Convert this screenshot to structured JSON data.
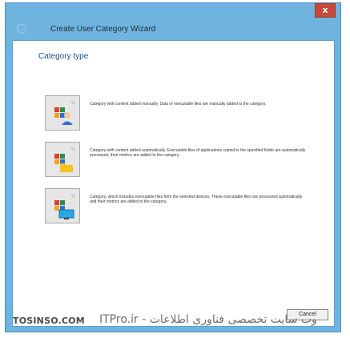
{
  "window": {
    "title": "Create User Category Wizard",
    "close_label": "x"
  },
  "page": {
    "section_title": "Category type"
  },
  "options": [
    {
      "icon": "manual-category-icon",
      "description": "Category with content added manually. Data of executable files are manually added to the category."
    },
    {
      "icon": "auto-folder-category-icon",
      "description": "Category with content added automatically. Executable files of applications copied to the specified folder are automatically processed, their metrics are added to the category."
    },
    {
      "icon": "device-category-icon",
      "description": "Category, which includes executable files from the selected devices. These executable files are processed automatically and their metrics are added to the category."
    }
  ],
  "footer": {
    "cancel_label": "Cancel"
  },
  "watermark": {
    "left": "TOSINSO.COM",
    "right": "ITPro.ir - وب سایت تخصصی فناوری اطلاعات"
  },
  "colors": {
    "frame": "#6fb4df",
    "close": "#c7493a",
    "section_title": "#1e4f8a"
  }
}
